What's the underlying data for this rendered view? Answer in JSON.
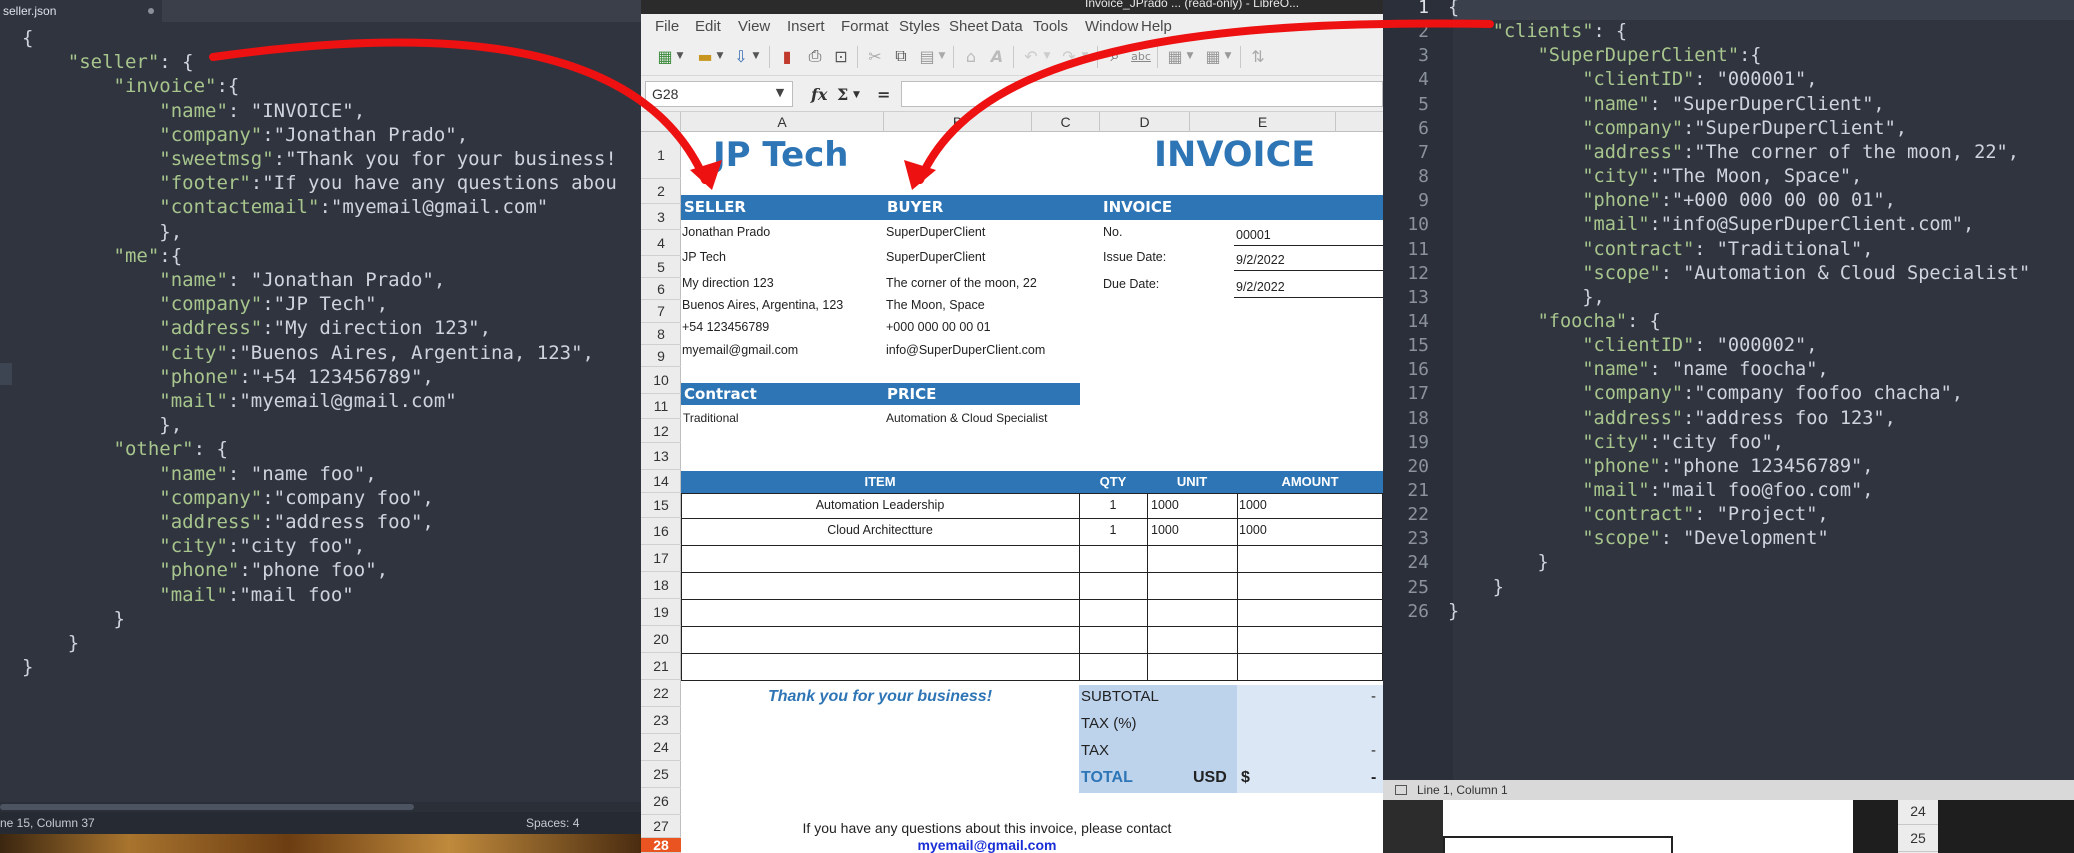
{
  "left_editor": {
    "tab": "seller.json",
    "status_position": "ne 15, Column 37",
    "status_spaces": "Spaces: 4",
    "lines": [
      "{",
      "    \"seller\": {",
      "        \"invoice\":{",
      "            \"name\": \"INVOICE\",",
      "            \"company\":\"Jonathan Prado\",",
      "            \"sweetmsg\":\"Thank you for your business!",
      "            \"footer\":\"If you have any questions abou",
      "            \"contactemail\":\"myemail@gmail.com\"",
      "            },",
      "        \"me\":{",
      "            \"name\": \"Jonathan Prado\",",
      "            \"company\":\"JP Tech\",",
      "            \"address\":\"My direction 123\",",
      "            \"city\":\"Buenos Aires, Argentina, 123\",",
      "            \"phone\":\"+54 123456789\",",
      "            \"mail\":\"myemail@gmail.com\"",
      "            },",
      "        \"other\": {",
      "            \"name\": \"name foo\",",
      "            \"company\":\"company foo\",",
      "            \"address\":\"address foo\",",
      "            \"city\":\"city foo\",",
      "            \"phone\":\"phone foo\",",
      "            \"mail\":\"mail foo\"",
      "        }",
      "    }",
      "}"
    ]
  },
  "calc": {
    "title": "Invoice_JPrado ... (read-only) - LibreO...",
    "menu": [
      "File",
      "Edit",
      "View",
      "Insert",
      "Format",
      "Styles",
      "Sheet",
      "Data",
      "Tools",
      "Window",
      "Help"
    ],
    "name_box": "G28",
    "formula_buttons": [
      "fx",
      "Σ",
      "="
    ],
    "columns": [
      "A",
      "B",
      "C",
      "D",
      "E"
    ],
    "rows": [
      "1",
      "2",
      "3",
      "4",
      "5",
      "6",
      "7",
      "8",
      "9",
      "10",
      "11",
      "12",
      "13",
      "14",
      "15",
      "16",
      "17",
      "18",
      "19",
      "20",
      "21",
      "22",
      "23",
      "24",
      "25",
      "26",
      "27",
      "28"
    ],
    "active_row": "28",
    "company_title": "JP Tech",
    "invoice_title": "INVOICE",
    "seller_header": "SELLER",
    "buyer_header": "BUYER",
    "invoice_header": "INVOICE",
    "seller": [
      "Jonathan Prado",
      "JP Tech",
      "My direction 123",
      "Buenos Aires, Argentina, 123",
      "+54 123456789",
      "myemail@gmail.com"
    ],
    "buyer": [
      "SuperDuperClient",
      "SuperDuperClient",
      "The corner of the moon, 22",
      "The Moon, Space",
      "+000 000 00 00 01",
      "info@SuperDuperClient.com"
    ],
    "invoice_fields": [
      {
        "label": "No.",
        "value": "00001"
      },
      {
        "label": "Issue Date:",
        "value": "9/2/2022"
      },
      {
        "label": "Due Date:",
        "value": "9/2/2022"
      }
    ],
    "contract_header": "Contract",
    "price_header": "PRICE",
    "contract_value": "Traditional",
    "price_value": "Automation & Cloud Specialist",
    "items_headers": [
      "ITEM",
      "QTY",
      "UNIT",
      "AMOUNT"
    ],
    "items": [
      {
        "item": "Automation Leadership",
        "qty": "1",
        "unit": "1000",
        "amount": "1000"
      },
      {
        "item": "Cloud Architectture",
        "qty": "1",
        "unit": "1000",
        "amount": "1000"
      }
    ],
    "thank_you": "Thank you for your business!",
    "subtotal_label": "SUBTOTAL",
    "subtotal_value": "-",
    "taxpct_label": "TAX (%)",
    "tax_label": "TAX",
    "tax_value": "-",
    "total_label": "TOTAL",
    "total_currency": "USD",
    "total_symbol": "$",
    "total_value": "-",
    "footer_text": "If you have any questions about this invoice, please contact",
    "footer_email": "myemail@gmail.com"
  },
  "right_editor": {
    "status_position": "Line 1, Column 1",
    "lines": [
      "{",
      "    \"clients\": {",
      "        \"SuperDuperClient\":{",
      "            \"clientID\": \"000001\",",
      "            \"name\": \"SuperDuperClient\",",
      "            \"company\":\"SuperDuperClient\",",
      "            \"address\":\"The corner of the moon, 22\",",
      "            \"city\":\"The Moon, Space\",",
      "            \"phone\":\"+000 000 00 00 01\",",
      "            \"mail\":\"info@SuperDuperClient.com\",",
      "            \"contract\": \"Traditional\",",
      "            \"scope\": \"Automation & Cloud Specialist\"",
      "            },",
      "        \"foocha\": {",
      "            \"clientID\": \"000002\",",
      "            \"name\": \"name foocha\",",
      "            \"company\":\"company foofoo chacha\",",
      "            \"address\":\"address foo 123\",",
      "            \"city\":\"city foo\",",
      "            \"phone\":\"phone 123456789\",",
      "            \"mail\":\"mail foo@foo.com\",",
      "            \"contract\": \"Project\",",
      "            \"scope\": \"Development\"",
      "        }",
      "    }",
      "}"
    ],
    "line_numbers": [
      "1",
      "2",
      "3",
      "4",
      "5",
      "6",
      "7",
      "8",
      "9",
      "10",
      "11",
      "12",
      "13",
      "14",
      "15",
      "16",
      "17",
      "18",
      "19",
      "20",
      "21",
      "22",
      "23",
      "24",
      "25",
      "26"
    ]
  },
  "background_rows": [
    "24",
    "25"
  ],
  "colors": {
    "editor_bg": "#2f343f",
    "json_key": "#a7c58c",
    "invoice_blue": "#2e75b6",
    "annotation_red": "#ee1111",
    "active_row": "#e95420"
  }
}
